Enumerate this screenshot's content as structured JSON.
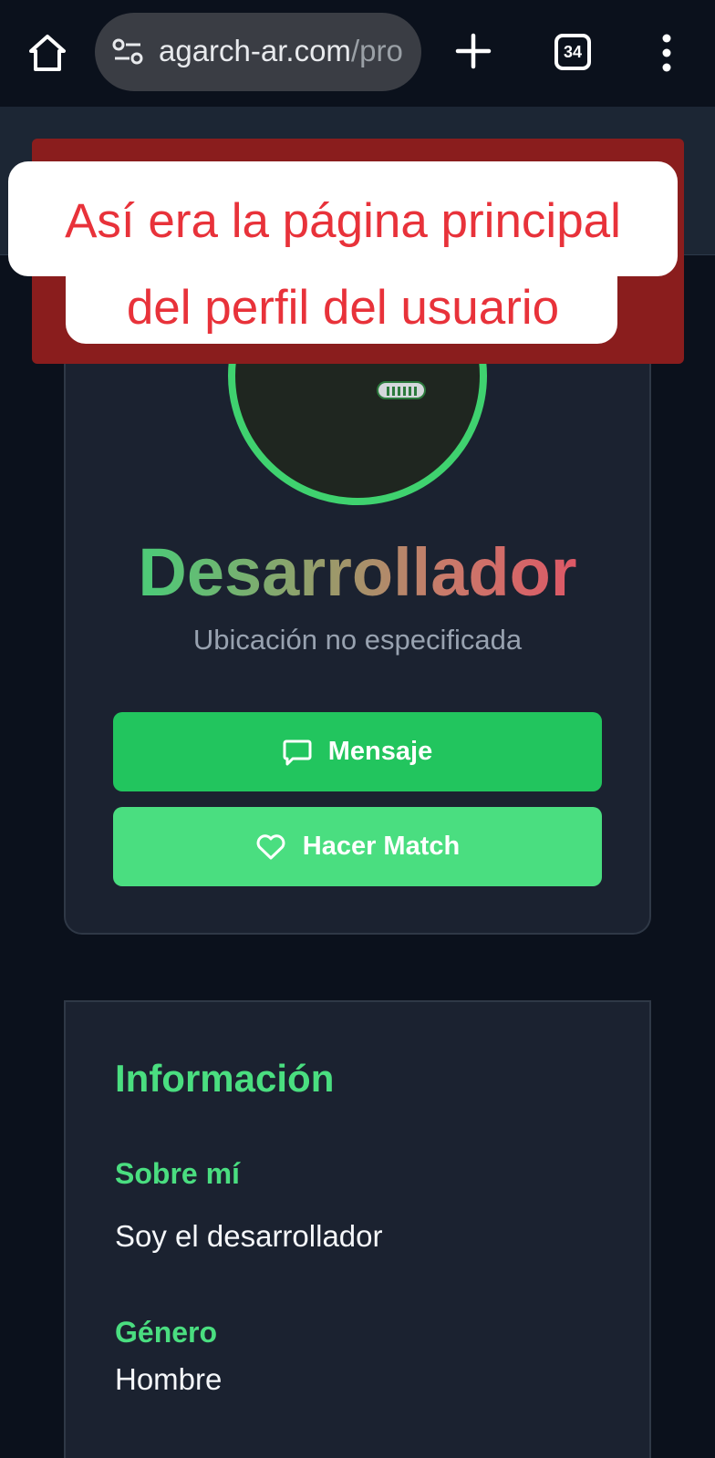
{
  "browser": {
    "url_main": "agarch-ar.com",
    "url_rest": "/pro",
    "tab_count": "34"
  },
  "profile": {
    "name": "Desarrollador",
    "location": "Ubicación no especificada",
    "message_button": "Mensaje",
    "match_button": "Hacer Match"
  },
  "info": {
    "title": "Información",
    "about_label": "Sobre mí",
    "about_value": "Soy el desarrollador",
    "gender_label": "Género",
    "gender_value": "Hombre"
  },
  "overlay": {
    "line1": "Así era la página principal",
    "line2": "del perfil del usuario"
  },
  "colors": {
    "accent": "#22c55e",
    "accent_light": "#4ade80",
    "overlay_red": "#8a1d1d",
    "caption_text": "#e8323a"
  },
  "icons": [
    "home-icon",
    "site-info-icon",
    "plus-icon",
    "tabs-icon",
    "more-vert-icon",
    "message-icon",
    "heart-icon"
  ]
}
